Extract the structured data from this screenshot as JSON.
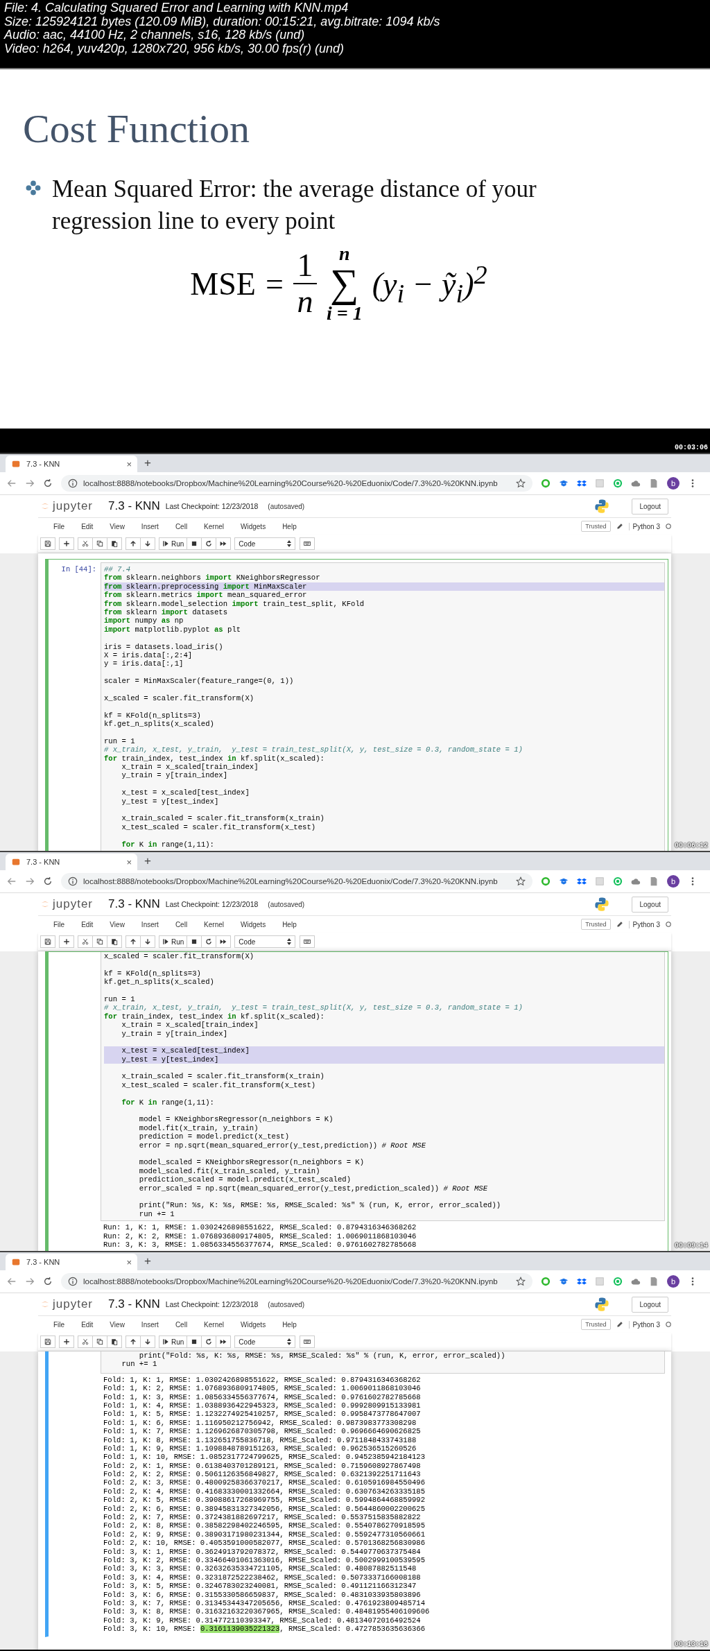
{
  "file_info": [
    "File: 4. Calculating Squared Error and Learning with KNN.mp4",
    "Size: 125924121 bytes (120.09 MiB), duration: 00:15:21, avg.bitrate: 1094 kb/s",
    "Audio: aac, 44100 Hz, 2 channels, s16, 128 kb/s (und)",
    "Video: h264, yuv420p, 1280x720, 956 kb/s, 30.00 fps(r) (und)"
  ],
  "frames": [
    {
      "kind": "slide",
      "timestamp": "00:03:06",
      "title": "Cost Function",
      "bullets": [
        "Mean Squared Error:  the average distance of your regression line to every point"
      ],
      "formula": {
        "lhs": "MSE",
        "equals": "=",
        "numerator": "1",
        "denominator": "n",
        "sum_symbol": "∑",
        "upper_limit": "n",
        "lower_limit": "i = 1",
        "summand": "(y$_{i}$ − ỹ$_{i}$)$^{2}$"
      }
    },
    {
      "kind": "notebook",
      "timestamp": "00:06:12",
      "browser": {
        "tab_title": "7.3 - KNN",
        "tab_close": "×",
        "new_tab": "+",
        "url": "localhost:8888/notebooks/Dropbox/Machine%20Learning%20Course%20-%20Eduonix/Code/7.3%20-%20KNN.ipynb",
        "avatar": "b"
      },
      "jupyter": {
        "logo": "jupyter",
        "title": "7.3 - KNN",
        "checkpoint": "Last Checkpoint: 12/23/2018",
        "autosave": "(autosaved)",
        "logout": "Logout",
        "menu": [
          "File",
          "Edit",
          "View",
          "Insert",
          "Cell",
          "Kernel",
          "Widgets",
          "Help"
        ],
        "trusted": "Trusted",
        "kernel": "Python 3",
        "run": "Run",
        "cell_type": "Code"
      },
      "cell": {
        "edit_mode": true,
        "prompt": "In [44]:",
        "lines": [
          {
            "kind": "comment",
            "text": "## 7.4",
            "selected": false
          },
          {
            "kind": "code",
            "text": "**from** sklearn.neighbors **import** KNeighborsRegressor",
            "selected": false
          },
          {
            "kind": "code",
            "text": "**from** sklearn.preprocessing **import** MinMaxScaler",
            "selected": true
          },
          {
            "kind": "code",
            "text": "**from** sklearn.metrics **import** mean_squared_error",
            "selected": false
          },
          {
            "kind": "code",
            "text": "**from** sklearn.model_selection **import** train_test_split, KFold",
            "selected": false
          },
          {
            "kind": "code",
            "text": "**from** sklearn **import** datasets",
            "selected": false
          },
          {
            "kind": "code",
            "text": "**import** numpy **as** np",
            "selected": false
          },
          {
            "kind": "code",
            "text": "**import** matplotlib.pyplot **as** plt",
            "selected": false
          },
          {
            "kind": "blank",
            "selected": false
          },
          {
            "kind": "code",
            "text": "iris = datasets.load_iris()",
            "selected": false
          },
          {
            "kind": "code",
            "text": "X = iris.data[:,2:4]",
            "selected": false
          },
          {
            "kind": "code",
            "text": "y = iris.data[:,1]",
            "selected": false
          },
          {
            "kind": "blank",
            "selected": false
          },
          {
            "kind": "code",
            "text": "scaler = MinMaxScaler(feature_range=(0, 1))",
            "selected": false
          },
          {
            "kind": "blank",
            "selected": false
          },
          {
            "kind": "code",
            "text": "x_scaled = scaler.fit_transform(X)",
            "selected": false
          },
          {
            "kind": "blank",
            "selected": false
          },
          {
            "kind": "code",
            "text": "kf = KFold(n_splits=3)",
            "selected": false
          },
          {
            "kind": "code",
            "text": "kf.get_n_splits(x_scaled)",
            "selected": false
          },
          {
            "kind": "blank",
            "selected": false
          },
          {
            "kind": "code",
            "text": "run = 1",
            "selected": false
          },
          {
            "kind": "comment",
            "text": "# x_train, x_test, y_train,  y_test = train_test_split(X, y, test_size = 0.3, random_state = 1)",
            "selected": false
          },
          {
            "kind": "code",
            "text": "**for** train_index, test_index **in** kf.split(x_scaled):",
            "selected": false
          },
          {
            "kind": "code",
            "text": "    x_train = x_scaled[train_index]",
            "selected": false
          },
          {
            "kind": "code",
            "text": "    y_train = y[train_index]",
            "selected": false
          },
          {
            "kind": "blank",
            "selected": false
          },
          {
            "kind": "code",
            "text": "    x_test = x_scaled[test_index]",
            "selected": false
          },
          {
            "kind": "code",
            "text": "    y_test = y[test_index]",
            "selected": false
          },
          {
            "kind": "blank",
            "selected": false
          },
          {
            "kind": "code",
            "text": "    x_train_scaled = scaler.fit_transform(x_train)",
            "selected": false
          },
          {
            "kind": "code",
            "text": "    x_test_scaled = scaler.fit_transform(x_test)",
            "selected": false
          },
          {
            "kind": "blank",
            "selected": false
          },
          {
            "kind": "code",
            "text": "    **for** K **in** range(1,11):",
            "selected": false
          }
        ]
      }
    },
    {
      "kind": "notebook",
      "timestamp": "00:09:14",
      "browser": {
        "tab_title": "7.3 - KNN",
        "tab_close": "×",
        "new_tab": "+",
        "url": "localhost:8888/notebooks/Dropbox/Machine%20Learning%20Course%20-%20Eduonix/Code/7.3%20-%20KNN.ipynb",
        "avatar": "b"
      },
      "jupyter": {
        "logo": "jupyter",
        "title": "7.3 - KNN",
        "checkpoint": "Last Checkpoint: 12/23/2018",
        "autosave": "(autosaved)",
        "logout": "Logout",
        "menu": [
          "File",
          "Edit",
          "View",
          "Insert",
          "Cell",
          "Kernel",
          "Widgets",
          "Help"
        ],
        "trusted": "Trusted",
        "kernel": "Python 3",
        "run": "Run",
        "cell_type": "Code"
      },
      "cell": {
        "edit_mode": true,
        "lines": [
          {
            "kind": "code",
            "text": "x_scaled = scaler.fit_transform(X)",
            "selected": false
          },
          {
            "kind": "blank",
            "selected": false
          },
          {
            "kind": "code",
            "text": "kf = KFold(n_splits=3)",
            "selected": false
          },
          {
            "kind": "code",
            "text": "kf.get_n_splits(x_scaled)",
            "selected": false
          },
          {
            "kind": "blank",
            "selected": false
          },
          {
            "kind": "code",
            "text": "run = 1",
            "selected": false
          },
          {
            "kind": "comment",
            "text": "# x_train, x_test, y_train,  y_test = train_test_split(X, y, test_size = 0.3, random_state = 1)",
            "selected": false
          },
          {
            "kind": "code",
            "text": "**for** train_index, test_index **in** kf.split(x_scaled):",
            "selected": false
          },
          {
            "kind": "code",
            "text": "    x_train = x_scaled[train_index]",
            "selected": false
          },
          {
            "kind": "code",
            "text": "    y_train = y[train_index]",
            "selected": false
          },
          {
            "kind": "blank",
            "selected": false
          },
          {
            "kind": "code",
            "text": "    x_test = x_scaled[test_index]",
            "selected": true
          },
          {
            "kind": "code",
            "text": "    y_test = y[test_index]",
            "selected": true
          },
          {
            "kind": "blank",
            "selected": false
          },
          {
            "kind": "code",
            "text": "    x_train_scaled = scaler.fit_transform(x_train)",
            "selected": false
          },
          {
            "kind": "code",
            "text": "    x_test_scaled = scaler.fit_transform(x_test)",
            "selected": false
          },
          {
            "kind": "blank",
            "selected": false
          },
          {
            "kind": "code",
            "text": "    **for** K **in** range(1,11):",
            "selected": false
          },
          {
            "kind": "blank",
            "selected": false
          },
          {
            "kind": "code",
            "text": "        model = KNeighborsRegressor(n_neighbors = K)",
            "selected": false
          },
          {
            "kind": "code",
            "text": "        model.fit(x_train, y_train)",
            "selected": false
          },
          {
            "kind": "code",
            "text": "        prediction = model.predict(x_test)",
            "selected": false
          },
          {
            "kind": "code",
            "text": "        error = np.sqrt(mean_squared_error(y_test,prediction)) *# Root MSE*",
            "selected": false
          },
          {
            "kind": "blank",
            "selected": false
          },
          {
            "kind": "code",
            "text": "        model_scaled = KNeighborsRegressor(n_neighbors = K)",
            "selected": false
          },
          {
            "kind": "code",
            "text": "        model_scaled.fit(x_train_scaled, y_train)",
            "selected": false
          },
          {
            "kind": "code",
            "text": "        prediction_scaled = model.predict(x_test_scaled)",
            "selected": false
          },
          {
            "kind": "code",
            "text": "        error_scaled = np.sqrt(mean_squared_error(y_test,prediction_scaled)) *# Root MSE*",
            "selected": false
          },
          {
            "kind": "blank",
            "selected": false
          },
          {
            "kind": "code",
            "text": "        print(\"Run: %s, K: %s, RMSE: %s, RMSE_Scaled: %s\" % (run, K, error, error_scaled))",
            "selected": false
          },
          {
            "kind": "code",
            "text": "        run += 1",
            "selected": false
          }
        ],
        "outputs": [
          {
            "kind": "plain",
            "text": "Run: 1, K: 1, RMSE: 1.0302426898551622, RMSE_Scaled: 0.8794316346368262"
          },
          {
            "kind": "plain",
            "text": "Run: 2, K: 2, RMSE: 1.0768936809174805, RMSE_Scaled: 1.0069011868103046"
          },
          {
            "kind": "plain",
            "text": "Run: 3, K: 3, RMSE: 1.0856334556377674, RMSE_Scaled: 0.9761602782785668"
          }
        ]
      }
    },
    {
      "kind": "notebook",
      "timestamp": "00:13:18",
      "browser": {
        "tab_title": "7.3 - KNN",
        "tab_close": "×",
        "new_tab": "+",
        "url": "localhost:8888/notebooks/Dropbox/Machine%20Learning%20Course%20-%20Eduonix/Code/7.3%20-%20KNN.ipynb",
        "avatar": "b"
      },
      "jupyter": {
        "logo": "jupyter",
        "title": "7.3 - KNN",
        "checkpoint": "Last Checkpoint: 12/23/2018",
        "autosave": "(autosaved)",
        "logout": "Logout",
        "menu": [
          "File",
          "Edit",
          "View",
          "Insert",
          "Cell",
          "Kernel",
          "Widgets",
          "Help"
        ],
        "trusted": "Trusted",
        "kernel": "Python 3",
        "run": "Run",
        "cell_type": "Code"
      },
      "cell": {
        "edit_mode": false,
        "lines": [
          {
            "kind": "code",
            "text": "        print(\"Fold: %s, K: %s, RMSE: %s, RMSE_Scaled: %s\" % (run, K, error, error_scaled))",
            "selected": false
          },
          {
            "kind": "code",
            "text": "    run += 1",
            "selected": false
          }
        ],
        "outputs": [
          {
            "kind": "plain",
            "text": "Fold: 1, K: 1, RMSE: 1.0302426898551622, RMSE_Scaled: 0.8794316346368262"
          },
          {
            "kind": "plain",
            "text": "Fold: 1, K: 2, RMSE: 1.0768936809174805, RMSE_Scaled: 1.0069011868103046"
          },
          {
            "kind": "plain",
            "text": "Fold: 1, K: 3, RMSE: 1.0856334556377674, RMSE_Scaled: 0.9761602782785668"
          },
          {
            "kind": "plain",
            "text": "Fold: 1, K: 4, RMSE: 1.0388936422945323, RMSE_Scaled: 0.9992809915133981"
          },
          {
            "kind": "plain",
            "text": "Fold: 1, K: 5, RMSE: 1.1232274925410257, RMSE_Scaled: 0.9958473778647007"
          },
          {
            "kind": "plain",
            "text": "Fold: 1, K: 6, RMSE: 1.116950212756942, RMSE_Scaled: 0.9873983773308298"
          },
          {
            "kind": "plain",
            "text": "Fold: 1, K: 7, RMSE: 1.1269626870305798, RMSE_Scaled: 0.9696664690626825"
          },
          {
            "kind": "plain",
            "text": "Fold: 1, K: 8, RMSE: 1.132651755836718, RMSE_Scaled: 0.9711848433743188"
          },
          {
            "kind": "plain",
            "text": "Fold: 1, K: 9, RMSE: 1.1098848789151263, RMSE_Scaled: 0.962536515260526"
          },
          {
            "kind": "plain",
            "text": "Fold: 1, K: 10, RMSE: 1.0852317724799625, RMSE_Scaled: 0.9452385942184123"
          },
          {
            "kind": "plain",
            "text": "Fold: 2, K: 1, RMSE: 0.6138403701289121, RMSE_Scaled: 0.7159608927867498"
          },
          {
            "kind": "plain",
            "text": "Fold: 2, K: 2, RMSE: 0.5061126356849827, RMSE_Scaled: 0.6321392251711643"
          },
          {
            "kind": "plain",
            "text": "Fold: 2, K: 3, RMSE: 0.48009258366370217, RMSE_Scaled: 0.6105916984550496"
          },
          {
            "kind": "plain",
            "text": "Fold: 2, K: 4, RMSE: 0.41683330001332664, RMSE_Scaled: 0.6307634263335185"
          },
          {
            "kind": "plain",
            "text": "Fold: 2, K: 5, RMSE: 0.39088617268969755, RMSE_Scaled: 0.5994864468859992"
          },
          {
            "kind": "plain",
            "text": "Fold: 2, K: 6, RMSE: 0.38945831327342056, RMSE_Scaled: 0.5644860002200625"
          },
          {
            "kind": "plain",
            "text": "Fold: 2, K: 7, RMSE: 0.3724381882697217, RMSE_Scaled: 0.5537515835882822"
          },
          {
            "kind": "plain",
            "text": "Fold: 2, K: 8, RMSE: 0.38582298402246595, RMSE_Scaled: 0.5540786270918595"
          },
          {
            "kind": "plain",
            "text": "Fold: 2, K: 9, RMSE: 0.38903171980231344, RMSE_Scaled: 0.5592477310560661"
          },
          {
            "kind": "plain",
            "text": "Fold: 2, K: 10, RMSE: 0.4053591000582077, RMSE_Scaled: 0.5701368256830986"
          },
          {
            "kind": "plain",
            "text": "Fold: 3, K: 1, RMSE: 0.3624913792078372, RMSE_Scaled: 0.5449770637375484"
          },
          {
            "kind": "plain",
            "text": "Fold: 3, K: 2, RMSE: 0.33466401061363016, RMSE_Scaled: 0.5002999100539595"
          },
          {
            "kind": "plain",
            "text": "Fold: 3, K: 3, RMSE: 0.32632635334721105, RMSE_Scaled: 0.48087882511548"
          },
          {
            "kind": "plain",
            "text": "Fold: 3, K: 4, RMSE: 0.3231872522238462, RMSE_Scaled: 0.5073337166008188"
          },
          {
            "kind": "plain",
            "text": "Fold: 3, K: 5, RMSE: 0.3246783023240081, RMSE_Scaled: 0.491121166312347"
          },
          {
            "kind": "plain",
            "text": "Fold: 3, K: 6, RMSE: 0.3155330586659837, RMSE_Scaled: 0.4831033935803896"
          },
          {
            "kind": "plain",
            "text": "Fold: 3, K: 7, RMSE: 0.31345344347205656, RMSE_Scaled: 0.4761923809485714"
          },
          {
            "kind": "plain",
            "text": "Fold: 3, K: 8, RMSE: 0.31632163220367965, RMSE_Scaled: 0.48481955406109606"
          },
          {
            "kind": "plain",
            "text": "Fold: 3, K: 9, RMSE: 0.314772110393347, RMSE_Scaled: 0.48134072016492524"
          },
          {
            "kind": "marked",
            "text": "Fold: 3, K: 10, RMSE: ",
            "marked": "0.3161139035221323",
            "rest": ", RMSE_Scaled: 0.4727853635636366"
          }
        ]
      }
    }
  ]
}
